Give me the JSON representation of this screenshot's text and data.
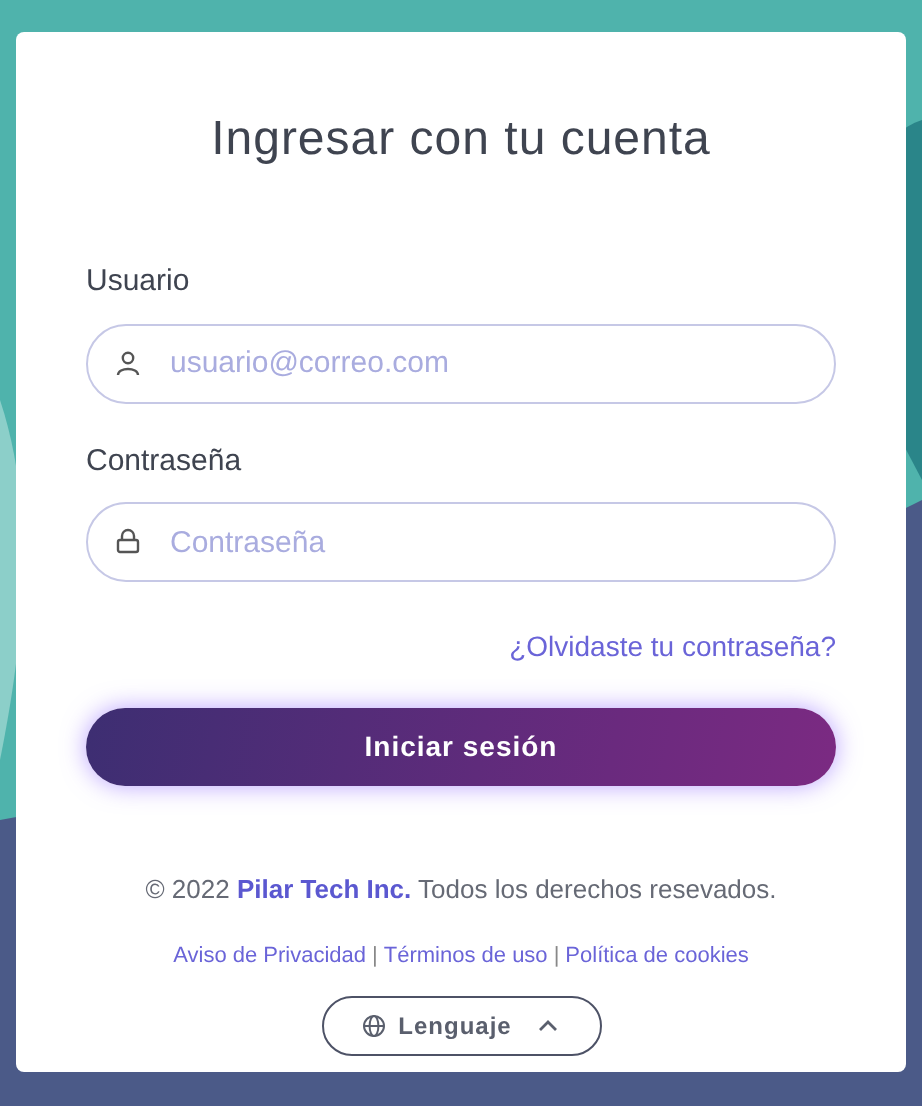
{
  "title": "Ingresar con tu cuenta",
  "fields": [
    {
      "label": "Usuario",
      "placeholder": "usuario@correo.com",
      "kind": "user"
    },
    {
      "label": "Contraseña",
      "placeholder": "Contraseña",
      "kind": "password"
    }
  ],
  "forgot_link": "¿Olvidaste tu contraseña?",
  "submit_button": "Iniciar sesión",
  "copyright": "© 2022 **Pilar Tech Inc.** Todos los derechos resevados.",
  "legal_links": [
    "Aviso de Privacidad",
    "Términos de uso",
    "Política de cookies"
  ],
  "link_separator": "|",
  "language_button": {
    "label": "Lenguaje",
    "expanded": true
  }
}
